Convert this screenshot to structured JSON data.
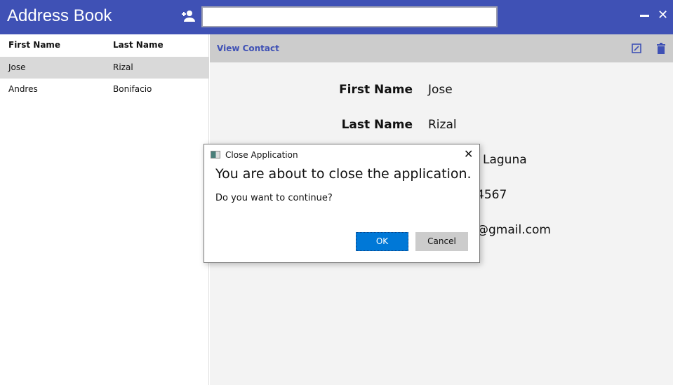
{
  "app": {
    "title": "Address Book",
    "search_value": "",
    "accent": "#3f51b5"
  },
  "list": {
    "headers": [
      "First Name",
      "Last Name"
    ],
    "rows": [
      {
        "first": "Jose",
        "last": "Rizal",
        "selected": true
      },
      {
        "first": "Andres",
        "last": "Bonifacio",
        "selected": false
      }
    ]
  },
  "detail": {
    "header": "View Contact",
    "fields": [
      {
        "label": "First Name",
        "value": "Jose"
      },
      {
        "label": "Last Name",
        "value": "Rizal"
      },
      {
        "label": "",
        "value": "Laguna"
      },
      {
        "label": "",
        "value": "4567"
      },
      {
        "label": "",
        "value": "@gmail.com"
      }
    ]
  },
  "dialog": {
    "title": "Close Application",
    "message": "You are about to close the application.",
    "question": "Do you want to continue?",
    "ok": "OK",
    "cancel": "Cancel"
  },
  "icons": {
    "add": "add-user-icon",
    "min": "minimize-icon",
    "close": "close-icon",
    "edit": "edit-icon",
    "delete": "trash-icon"
  }
}
